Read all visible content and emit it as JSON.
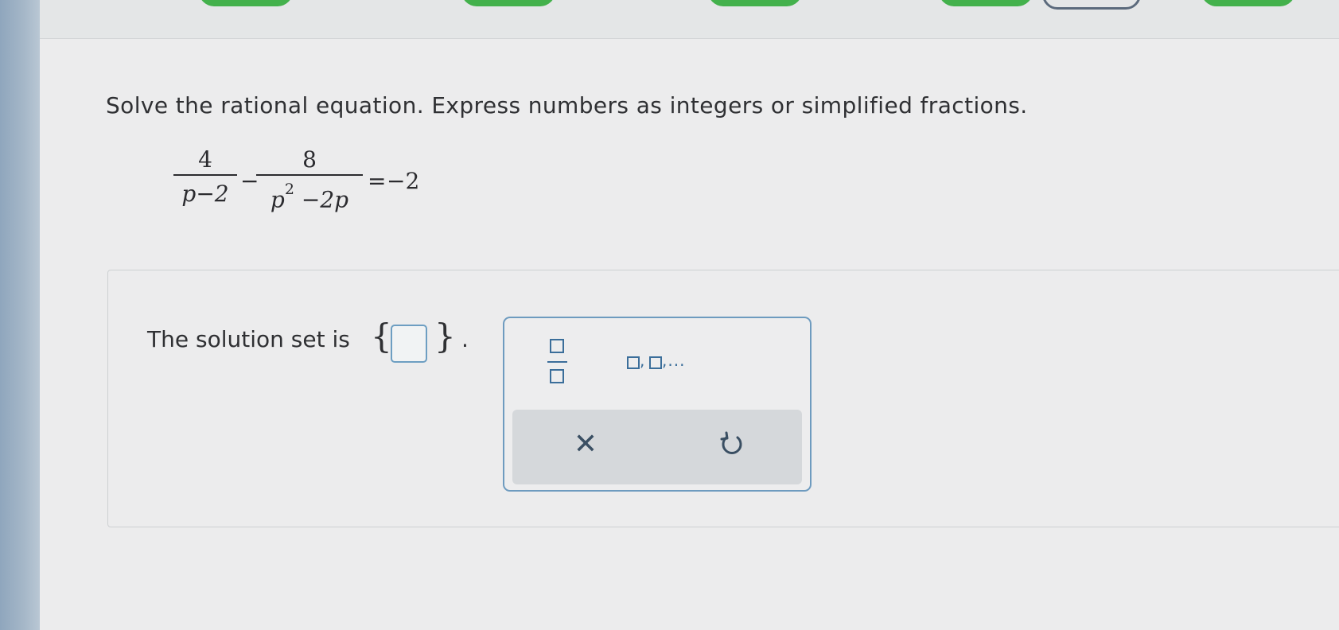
{
  "prompt": "Solve the rational equation. Express numbers as integers or simplified fractions.",
  "equation": {
    "term1_numerator": "4",
    "term1_denominator": "p−2",
    "minus": "−",
    "term2_numerator": "8",
    "term2_denominator_base": "p",
    "term2_denominator_exp": "2",
    "term2_denominator_rest": " −2p",
    "equals": "=",
    "rhs": "−2"
  },
  "answer": {
    "label": "The solution set is",
    "open_brace": "{",
    "close_brace": "}",
    "period": ".",
    "input_value": ""
  },
  "toolbox": {
    "list_tool_text": ",",
    "list_tool_ellipsis": ",...",
    "clear_symbol": "✕"
  },
  "colors": {
    "accent": "#3b6e9a",
    "input_border": "#6d9ec2",
    "nav_green": "#43b14c"
  },
  "icons": [
    "fraction-template-icon",
    "list-template-icon",
    "clear-icon",
    "undo-icon"
  ]
}
